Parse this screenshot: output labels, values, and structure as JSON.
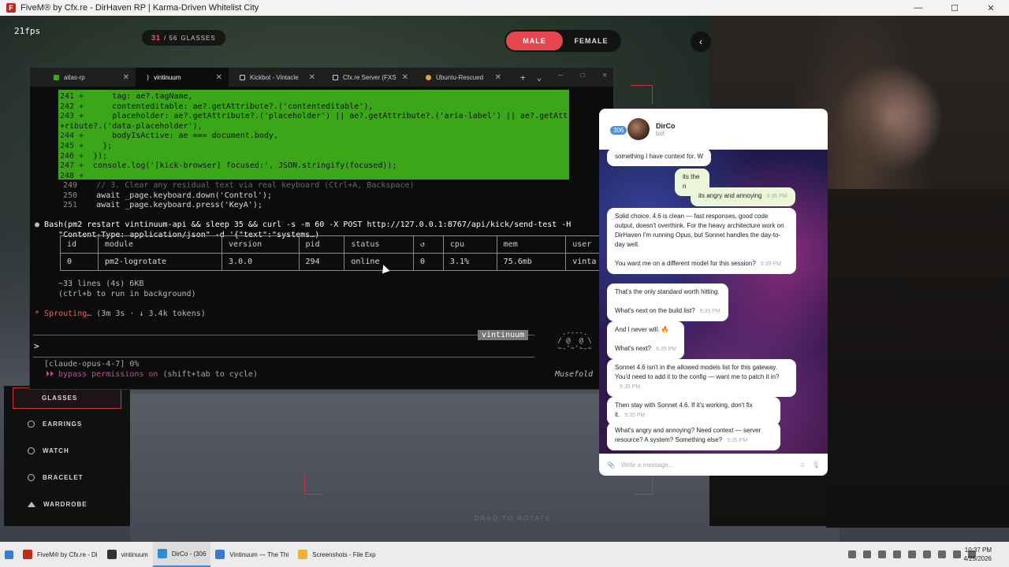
{
  "window": {
    "title": "FiveM® by Cfx.re - DirHaven RP | Karma-Driven Whitelist City"
  },
  "hud": {
    "fps": "21fps",
    "glasses_current": "31",
    "glasses_total": "/ 56",
    "glasses_label": "GLASSES",
    "gender_male": "MALE",
    "gender_female": "FEMALE",
    "back_icon": "‹",
    "drag_hint": "DRAG TO ROTATE"
  },
  "clothing_menu": {
    "items": [
      {
        "label": "GLASSES",
        "active": true
      },
      {
        "label": "EARRINGS"
      },
      {
        "label": "WATCH"
      },
      {
        "label": "BRACELET"
      },
      {
        "label": "WARDROBE"
      }
    ]
  },
  "terminal": {
    "tabs": [
      {
        "label": "atlas-rp",
        "color": "#3aa618"
      },
      {
        "label": "vintinuum",
        "color": "#ffffff",
        "active": true
      },
      {
        "label": "Kickbot - Vintacle",
        "color": "#cccccc"
      },
      {
        "label": "Cfx.re Server (FXS",
        "color": "#cccccc"
      },
      {
        "label": "Ubuntu-Rescued",
        "color": "#e9a23b"
      }
    ],
    "diff_lines": [
      {
        "n": "241 +",
        "text": "      tag: ae?.tagName,"
      },
      {
        "n": "242 +",
        "text": "      contenteditable: ae?.getAttribute?.('contenteditable'),"
      },
      {
        "n": "243 +",
        "text": "      placeholder: ae?.getAttribute?.('placeholder') || ae?.getAttribute?.('aria-label') || ae?.getAtt"
      },
      {
        "n": "",
        "text": "+ribute?.('data-placeholder'),"
      },
      {
        "n": "244 +",
        "text": "      bodyIsActive: ae === document.body,"
      },
      {
        "n": "245 +",
        "text": "    };"
      },
      {
        "n": "246 +",
        "text": "  });"
      },
      {
        "n": "247 +",
        "text": "  console.log('[kick-browser] focused:', JSON.stringify(focused));"
      },
      {
        "n": "248 +",
        "text": ""
      }
    ],
    "ctx_lines": [
      {
        "n": "249",
        "text": "  // 3. Clear any residual text via real keyboard (Ctrl+A, Backspace)"
      },
      {
        "n": "250",
        "text": "  await _page.keyboard.down('Control');"
      },
      {
        "n": "251",
        "text": "  await _page.keyboard.press('KeyA');"
      }
    ],
    "bash_cmd": "Bash(pm2 restart vintinuum-api && sleep 35 && curl -s -m 60 -X POST http://127.0.0.1:8767/api/kick/send-test -H",
    "bash_cmd2": "     \"Content-Type: application/json\" -d '{\"text\":\"systems…)",
    "table": {
      "headers": [
        "id",
        "module",
        "version",
        "pid",
        "status",
        "↺",
        "cpu",
        "mem",
        "user"
      ],
      "rows": [
        [
          "0",
          "pm2-logrotate",
          "3.0.0",
          "294",
          "online",
          "0",
          "3.1%",
          "75.6mb",
          "vinta"
        ]
      ]
    },
    "more_lines": "~33 lines (4s) 6KB",
    "background_hint": "(ctrl+b to run in background)",
    "sprouting": "Sprouting…",
    "sprouting_detail": " (3m 3s · ↓ 3.4k tokens)",
    "prompt_badge": "vintinuum",
    "prompt_caret": ">",
    "mascot_art": "  .----.\n / @  @ \\\n ~-'~'~-~",
    "mascot_name": "Musefold",
    "model_line": "[claude-opus-4-7] 0%",
    "bypass_label": "⏵⏵ bypass permissions on",
    "bypass_rest": " (shift+tab to cycle)"
  },
  "chat": {
    "badge": "306",
    "name": "DirCo",
    "sub": "bot",
    "messages": [
      {
        "dir": "in",
        "text": "something I have context for. W"
      },
      {
        "dir": "out",
        "text": "its the n"
      },
      {
        "dir": "out",
        "text": "its angry and annoying",
        "time": "9:35 PM"
      },
      {
        "dir": "in",
        "text": "Solid choice. 4.6 is clean — fast responses, good code output, doesn't overthink. For the heavy architecture work on DirHaven I'm running Opus, but Sonnet handles the day-to-day well.\n\nYou want me on a different model for this session?",
        "time": "9:35 PM"
      },
      {
        "dir": "in",
        "text": "That's the only standard worth hitting.\n\nWhat's next on the build list?",
        "time": "9:35 PM"
      },
      {
        "dir": "in",
        "text": "And I never will. 🔥\n\nWhat's next?",
        "time": "9:35 PM"
      },
      {
        "dir": "in",
        "text": "Sonnet 4.6 isn't in the allowed models list for this gateway. You'd need to add it to the config — want me to patch it in?",
        "time": "9:35 PM"
      },
      {
        "dir": "in",
        "text": "Then stay with Sonnet 4.6. If it's working, don't fix it.",
        "time": "9:35 PM"
      },
      {
        "dir": "in",
        "text": "What's angry and annoying? Need context — server resource? A system? Something else?",
        "time": "9:35 PM"
      }
    ],
    "input_placeholder": "Write a message..."
  },
  "taskbar": {
    "items": [
      {
        "label": "FiveM® by Cfx.re - Di",
        "color": "#c0281e"
      },
      {
        "label": "vintinuum",
        "color": "#333333"
      },
      {
        "label": "DirCo - (306",
        "color": "#2e8bd6",
        "active": true
      },
      {
        "label": "Vintinuum — The Thi",
        "color": "#3a7bd5"
      },
      {
        "label": "Screenshots - File Exp",
        "color": "#e8b23a"
      }
    ],
    "time": "10:37 PM",
    "date": "4/25/2026"
  }
}
